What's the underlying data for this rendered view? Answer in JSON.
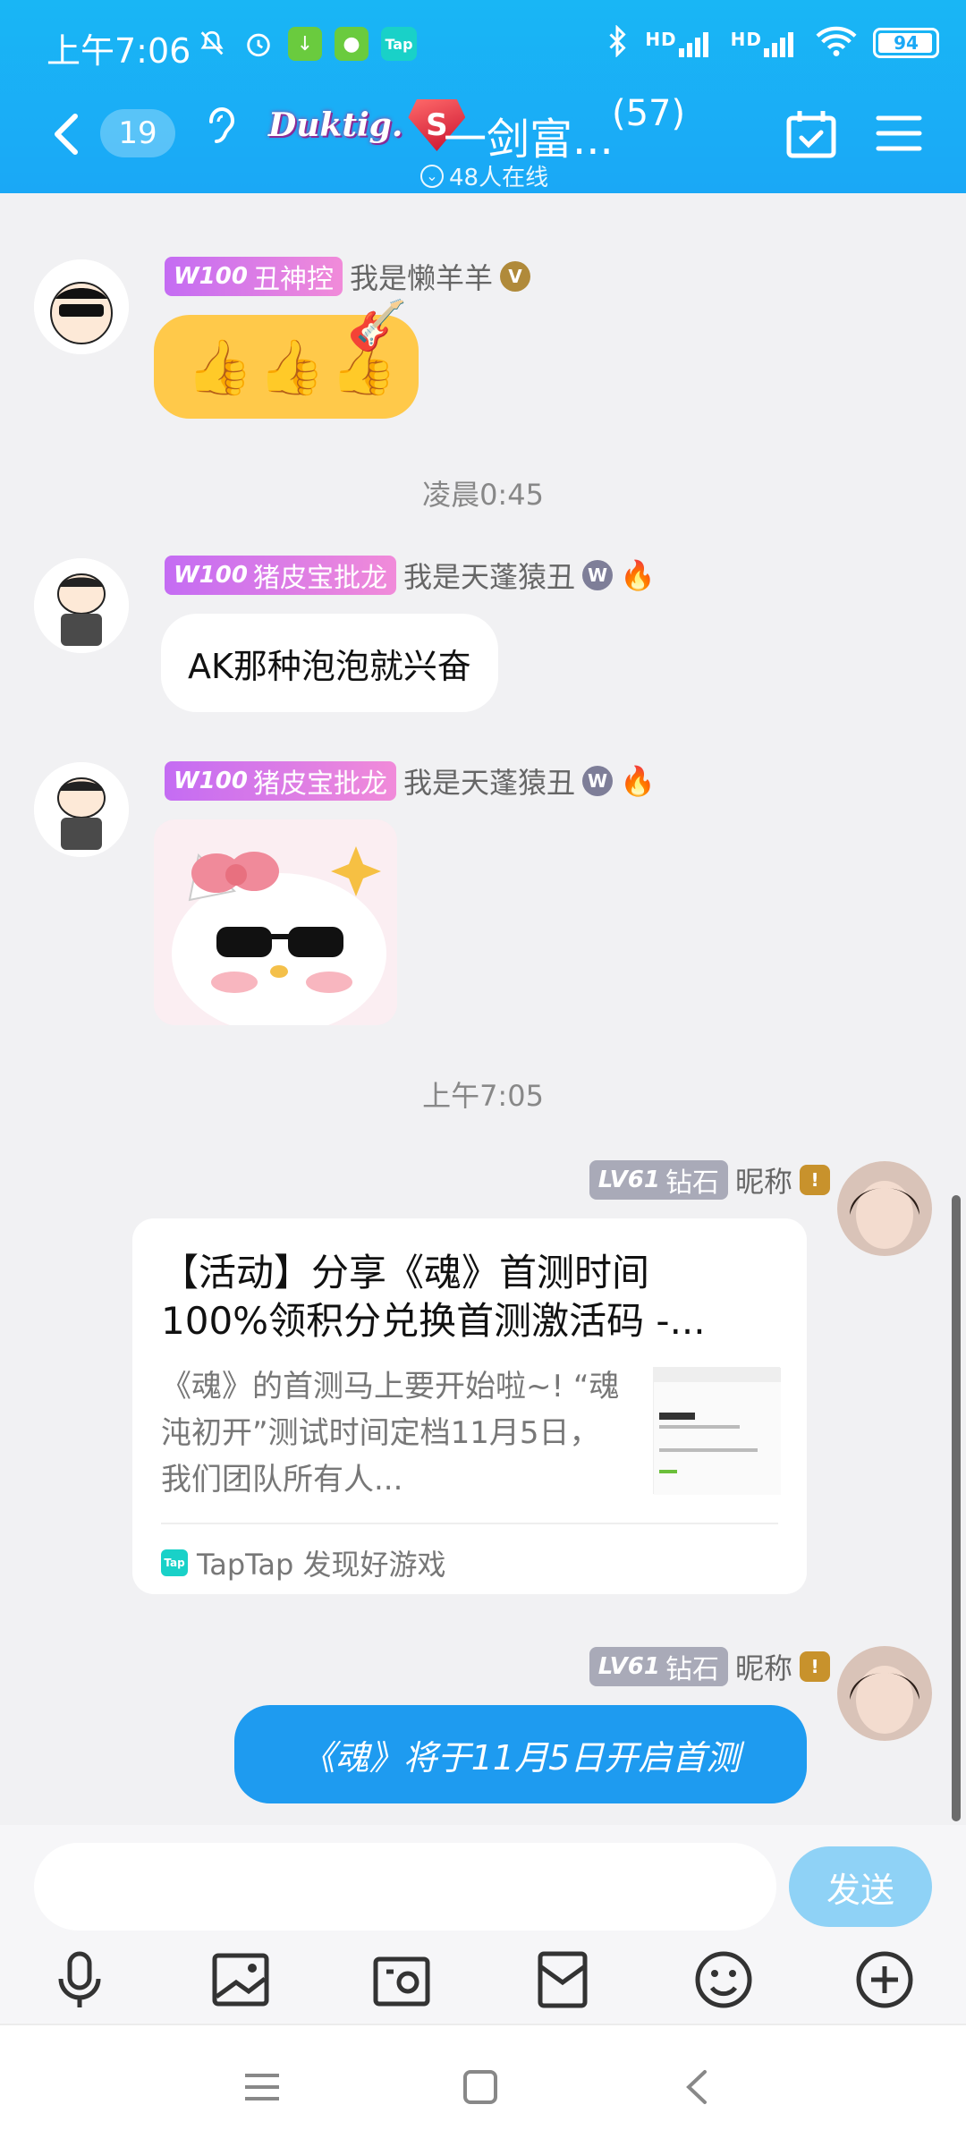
{
  "status_bar": {
    "time": "上午7:06",
    "battery": "94",
    "icons_left": [
      "mute-icon",
      "alarm-icon",
      "download-icon",
      "wechat-icon",
      "taptap-icon"
    ],
    "icons_right": [
      "bluetooth-icon",
      "signal-hd-icon",
      "signal-hd-icon",
      "wifi-icon",
      "battery-icon"
    ],
    "signal_label": "HD"
  },
  "header": {
    "unread_count": "19",
    "badge_text": "Duktig.",
    "gem_letter": "S",
    "group_title": "一剑富...",
    "member_count": "(57)",
    "online_text": "48人在线"
  },
  "messages": [
    {
      "type": "sticker-thumbs",
      "level_badge": "W100",
      "title_tag": "丑神控",
      "nickname": "我是懒羊羊",
      "content": "👍👍👍"
    },
    {
      "type": "timestamp",
      "text": "凌晨0:45"
    },
    {
      "type": "text",
      "level_badge": "W100",
      "title_tag": "猪皮宝批龙",
      "nickname": "我是天蓬猿丑",
      "content": "AK那种泡泡就兴奋"
    },
    {
      "type": "sticker",
      "level_badge": "W100",
      "title_tag": "猪皮宝批龙",
      "nickname": "我是天蓬猿丑"
    },
    {
      "type": "timestamp",
      "text": "上午7:05"
    },
    {
      "type": "card",
      "level_badge": "LV61",
      "title_tag": "钻石",
      "nickname": "昵称",
      "card_title": "【活动】分享《魂》首测时间100%领积分兑换首测激活码 -...",
      "card_desc": "《魂》的首测马上要开始啦~! “魂沌初开”测试时间定档11月5日，我们团队所有人...",
      "card_source": "TapTap 发现好游戏",
      "tap_logo": "Tap"
    },
    {
      "type": "text-blue",
      "level_badge": "LV61",
      "title_tag": "钻石",
      "nickname": "昵称",
      "content": "《魂》将于11月5日开启首测"
    }
  ],
  "input": {
    "placeholder": "",
    "send_label": "发送"
  },
  "toolbar": [
    "microphone-icon",
    "image-icon",
    "camera-icon",
    "red-packet-icon",
    "emoji-icon",
    "plus-icon"
  ],
  "colors": {
    "header": "#1aa8f6",
    "bubble_blue": "#1e9bf0",
    "send_disabled": "#8fd2f6"
  }
}
